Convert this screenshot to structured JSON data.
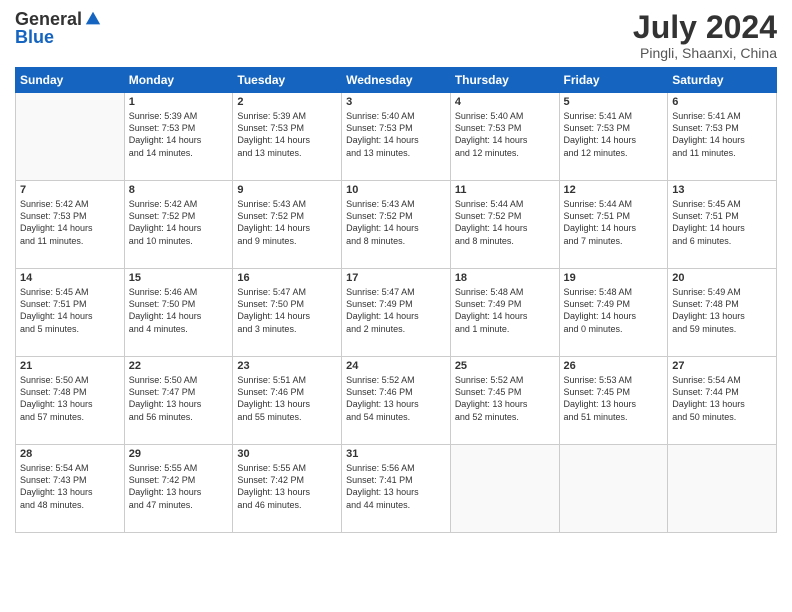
{
  "header": {
    "logo_general": "General",
    "logo_blue": "Blue",
    "month_year": "July 2024",
    "location": "Pingli, Shaanxi, China"
  },
  "weekdays": [
    "Sunday",
    "Monday",
    "Tuesday",
    "Wednesday",
    "Thursday",
    "Friday",
    "Saturday"
  ],
  "weeks": [
    [
      {
        "day": "",
        "content": ""
      },
      {
        "day": "1",
        "content": "Sunrise: 5:39 AM\nSunset: 7:53 PM\nDaylight: 14 hours\nand 14 minutes."
      },
      {
        "day": "2",
        "content": "Sunrise: 5:39 AM\nSunset: 7:53 PM\nDaylight: 14 hours\nand 13 minutes."
      },
      {
        "day": "3",
        "content": "Sunrise: 5:40 AM\nSunset: 7:53 PM\nDaylight: 14 hours\nand 13 minutes."
      },
      {
        "day": "4",
        "content": "Sunrise: 5:40 AM\nSunset: 7:53 PM\nDaylight: 14 hours\nand 12 minutes."
      },
      {
        "day": "5",
        "content": "Sunrise: 5:41 AM\nSunset: 7:53 PM\nDaylight: 14 hours\nand 12 minutes."
      },
      {
        "day": "6",
        "content": "Sunrise: 5:41 AM\nSunset: 7:53 PM\nDaylight: 14 hours\nand 11 minutes."
      }
    ],
    [
      {
        "day": "7",
        "content": "Sunrise: 5:42 AM\nSunset: 7:53 PM\nDaylight: 14 hours\nand 11 minutes."
      },
      {
        "day": "8",
        "content": "Sunrise: 5:42 AM\nSunset: 7:52 PM\nDaylight: 14 hours\nand 10 minutes."
      },
      {
        "day": "9",
        "content": "Sunrise: 5:43 AM\nSunset: 7:52 PM\nDaylight: 14 hours\nand 9 minutes."
      },
      {
        "day": "10",
        "content": "Sunrise: 5:43 AM\nSunset: 7:52 PM\nDaylight: 14 hours\nand 8 minutes."
      },
      {
        "day": "11",
        "content": "Sunrise: 5:44 AM\nSunset: 7:52 PM\nDaylight: 14 hours\nand 8 minutes."
      },
      {
        "day": "12",
        "content": "Sunrise: 5:44 AM\nSunset: 7:51 PM\nDaylight: 14 hours\nand 7 minutes."
      },
      {
        "day": "13",
        "content": "Sunrise: 5:45 AM\nSunset: 7:51 PM\nDaylight: 14 hours\nand 6 minutes."
      }
    ],
    [
      {
        "day": "14",
        "content": "Sunrise: 5:45 AM\nSunset: 7:51 PM\nDaylight: 14 hours\nand 5 minutes."
      },
      {
        "day": "15",
        "content": "Sunrise: 5:46 AM\nSunset: 7:50 PM\nDaylight: 14 hours\nand 4 minutes."
      },
      {
        "day": "16",
        "content": "Sunrise: 5:47 AM\nSunset: 7:50 PM\nDaylight: 14 hours\nand 3 minutes."
      },
      {
        "day": "17",
        "content": "Sunrise: 5:47 AM\nSunset: 7:49 PM\nDaylight: 14 hours\nand 2 minutes."
      },
      {
        "day": "18",
        "content": "Sunrise: 5:48 AM\nSunset: 7:49 PM\nDaylight: 14 hours\nand 1 minute."
      },
      {
        "day": "19",
        "content": "Sunrise: 5:48 AM\nSunset: 7:49 PM\nDaylight: 14 hours\nand 0 minutes."
      },
      {
        "day": "20",
        "content": "Sunrise: 5:49 AM\nSunset: 7:48 PM\nDaylight: 13 hours\nand 59 minutes."
      }
    ],
    [
      {
        "day": "21",
        "content": "Sunrise: 5:50 AM\nSunset: 7:48 PM\nDaylight: 13 hours\nand 57 minutes."
      },
      {
        "day": "22",
        "content": "Sunrise: 5:50 AM\nSunset: 7:47 PM\nDaylight: 13 hours\nand 56 minutes."
      },
      {
        "day": "23",
        "content": "Sunrise: 5:51 AM\nSunset: 7:46 PM\nDaylight: 13 hours\nand 55 minutes."
      },
      {
        "day": "24",
        "content": "Sunrise: 5:52 AM\nSunset: 7:46 PM\nDaylight: 13 hours\nand 54 minutes."
      },
      {
        "day": "25",
        "content": "Sunrise: 5:52 AM\nSunset: 7:45 PM\nDaylight: 13 hours\nand 52 minutes."
      },
      {
        "day": "26",
        "content": "Sunrise: 5:53 AM\nSunset: 7:45 PM\nDaylight: 13 hours\nand 51 minutes."
      },
      {
        "day": "27",
        "content": "Sunrise: 5:54 AM\nSunset: 7:44 PM\nDaylight: 13 hours\nand 50 minutes."
      }
    ],
    [
      {
        "day": "28",
        "content": "Sunrise: 5:54 AM\nSunset: 7:43 PM\nDaylight: 13 hours\nand 48 minutes."
      },
      {
        "day": "29",
        "content": "Sunrise: 5:55 AM\nSunset: 7:42 PM\nDaylight: 13 hours\nand 47 minutes."
      },
      {
        "day": "30",
        "content": "Sunrise: 5:55 AM\nSunset: 7:42 PM\nDaylight: 13 hours\nand 46 minutes."
      },
      {
        "day": "31",
        "content": "Sunrise: 5:56 AM\nSunset: 7:41 PM\nDaylight: 13 hours\nand 44 minutes."
      },
      {
        "day": "",
        "content": ""
      },
      {
        "day": "",
        "content": ""
      },
      {
        "day": "",
        "content": ""
      }
    ]
  ]
}
